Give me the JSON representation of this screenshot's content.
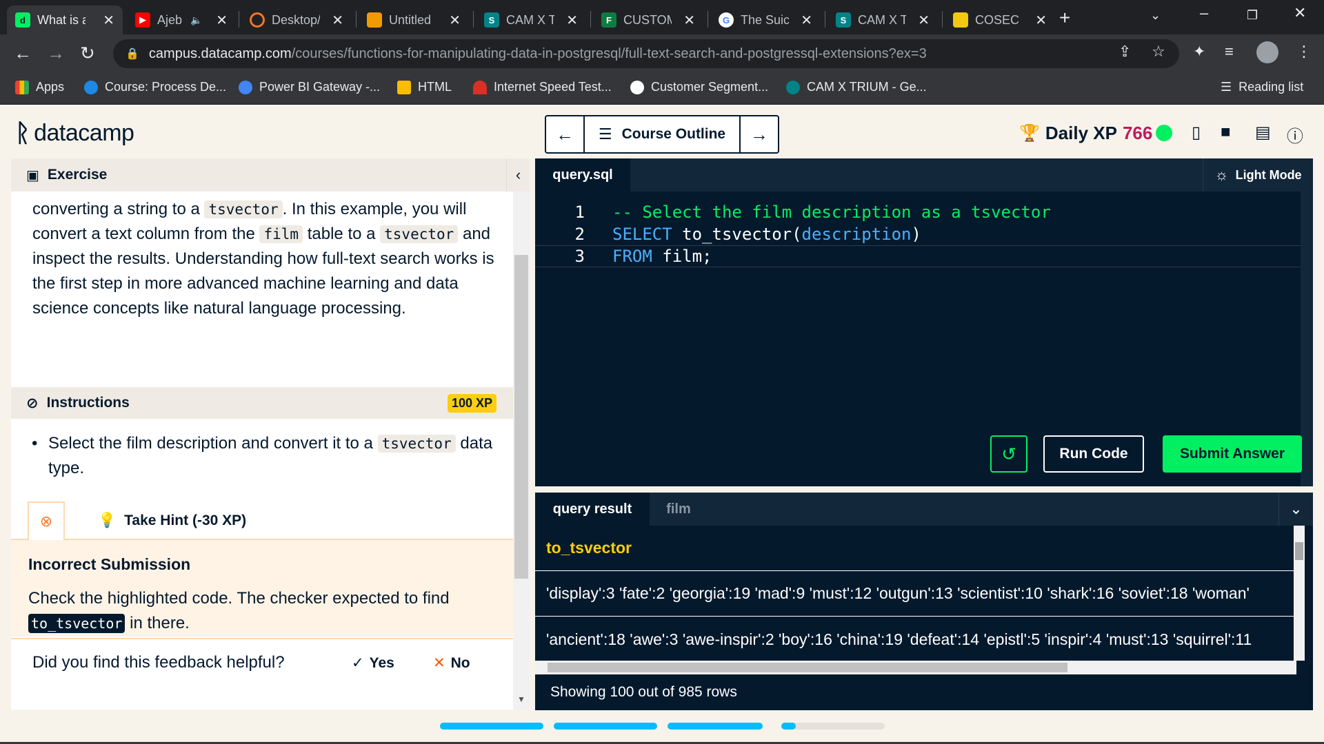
{
  "browser": {
    "tabs": [
      {
        "title": "What is a",
        "active": true,
        "favicon_color": "#03ef62"
      },
      {
        "title": "Ajeb",
        "active": false,
        "favicon_color": "#ff0000"
      },
      {
        "title": "Desktop/",
        "active": false,
        "favicon_color": "#f37626"
      },
      {
        "title": "Untitled",
        "active": false,
        "favicon_color": "#f29900"
      },
      {
        "title": "CAM X T",
        "active": false,
        "favicon_color": "#038387"
      },
      {
        "title": "CUSTOM",
        "active": false,
        "favicon_color": "#107c41"
      },
      {
        "title": "The Suic",
        "active": false,
        "favicon_color": "#4285f4"
      },
      {
        "title": "CAM X T",
        "active": false,
        "favicon_color": "#038387"
      },
      {
        "title": "COSEC N",
        "active": false,
        "favicon_color": "#f2c811"
      }
    ],
    "url_domain": "campus.datacamp.com",
    "url_path": "/courses/functions-for-manipulating-data-in-postgresql/full-text-search-and-postgressql-extensions?ex=3",
    "bookmarks": [
      {
        "label": "Apps",
        "color": "#ea4335"
      },
      {
        "label": "Course: Process De...",
        "color": "#1e88e5"
      },
      {
        "label": "Power BI Gateway -...",
        "color": "#4285f4"
      },
      {
        "label": "HTML",
        "color": "#fbbc04"
      },
      {
        "label": "Internet Speed Test...",
        "color": "#d93025"
      },
      {
        "label": "Customer Segment...",
        "color": "#ffffff"
      },
      {
        "label": "CAM X TRIUM - Ge...",
        "color": "#038387"
      }
    ],
    "reading_list": "Reading list"
  },
  "header": {
    "logo_text": "datacamp",
    "course_outline": "Course Outline",
    "daily_xp_label": "Daily XP",
    "daily_xp_value": "766",
    "status_color": "#03ef62"
  },
  "exercise": {
    "section_title": "Exercise",
    "text_parts": [
      "converting a string to a ",
      "tsvector",
      ". In this example, you will convert a text column from the ",
      "film",
      " table to a ",
      "tsvector",
      " and inspect the results. Understanding how full-text search works is the first step in more advanced machine learning and data science concepts like natural language processing."
    ]
  },
  "instructions": {
    "title": "Instructions",
    "xp_badge": "100 XP",
    "bullet_parts": [
      "Select the film description and convert it to a ",
      "tsvector",
      " data type."
    ],
    "hint_label": "Take Hint (-30 XP)"
  },
  "feedback": {
    "title": "Incorrect Submission",
    "text_before": "Check the highlighted code. The checker expected to find",
    "code": "to_tsvector",
    "text_after": " in there.",
    "question": "Did you find this feedback helpful?",
    "yes": "Yes",
    "no": "No"
  },
  "editor": {
    "file_tab": "query.sql",
    "light_mode": "Light Mode",
    "lines": [
      {
        "num": "1",
        "comment": "-- Select the film description as a tsvector"
      },
      {
        "num": "2",
        "kw": "SELECT",
        "fn": " to_tsvector(",
        "field": "description",
        "end": ")"
      },
      {
        "num": "3",
        "kw": "FROM",
        "rest": " film;"
      }
    ],
    "run_label": "Run Code",
    "submit_label": "Submit Answer"
  },
  "results": {
    "tabs": [
      "query result",
      "film"
    ],
    "column": "to_tsvector",
    "rows": [
      "'display':3 'fate':2 'georgia':19 'mad':9 'must':12 'outgun':13 'scientist':10 'shark':16 'soviet':18 'woman'",
      "'ancient':18 'awe':3 'awe-inspir':2 'boy':16 'china':19 'defeat':14 'epistl':5 'inspir':4 'must':13 'squirrel':11"
    ],
    "footer": "Showing 100 out of 985 rows"
  },
  "progress": {
    "segments": [
      1.0,
      1.0,
      1.0,
      0.14
    ]
  }
}
